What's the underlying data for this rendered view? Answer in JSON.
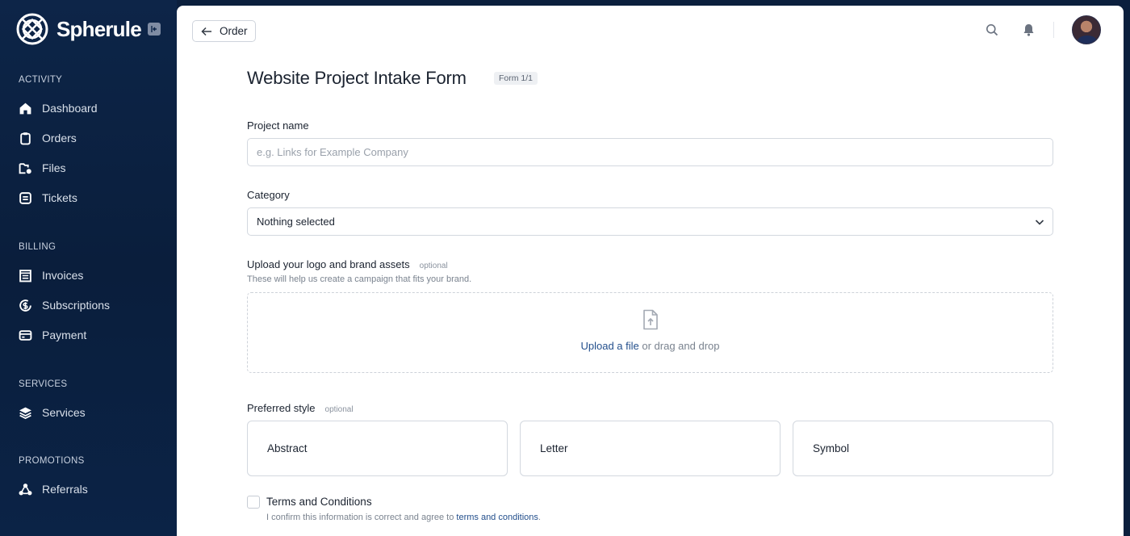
{
  "brand": {
    "name": "Spherule"
  },
  "sidebar": {
    "sections": [
      {
        "label": "ACTIVITY",
        "items": [
          {
            "label": "Dashboard",
            "icon": "home-icon"
          },
          {
            "label": "Orders",
            "icon": "clipboard-icon"
          },
          {
            "label": "Files",
            "icon": "folder-icon"
          },
          {
            "label": "Tickets",
            "icon": "ticket-icon"
          }
        ]
      },
      {
        "label": "BILLING",
        "items": [
          {
            "label": "Invoices",
            "icon": "receipt-icon"
          },
          {
            "label": "Subscriptions",
            "icon": "dollar-cycle-icon"
          },
          {
            "label": "Payment",
            "icon": "credit-card-icon"
          }
        ]
      },
      {
        "label": "SERVICES",
        "items": [
          {
            "label": "Services",
            "icon": "stack-icon"
          }
        ]
      },
      {
        "label": "PROMOTIONS",
        "items": [
          {
            "label": "Referrals",
            "icon": "share-nodes-icon"
          }
        ]
      }
    ]
  },
  "header": {
    "back_label": "Order"
  },
  "form": {
    "title": "Website Project Intake Form",
    "badge": "Form 1/1",
    "project_name": {
      "label": "Project name",
      "placeholder": "e.g. Links for Example Company",
      "value": ""
    },
    "category": {
      "label": "Category",
      "value": "Nothing selected"
    },
    "upload": {
      "label": "Upload your logo and brand assets",
      "optional": "optional",
      "hint": "These will help us create a campaign that fits your brand.",
      "link_text": "Upload a file",
      "rest_text": " or drag and drop"
    },
    "style": {
      "label": "Preferred style",
      "optional": "optional",
      "options": [
        "Abstract",
        "Letter",
        "Symbol"
      ]
    },
    "terms": {
      "label": "Terms and Conditions",
      "sub_text": "I confirm this information is correct and agree to ",
      "link_text": "terms and conditions",
      "sub_end": ".",
      "checked": false
    }
  },
  "colors": {
    "sidebar_bg": "#0b1f3d",
    "link": "#234f8c",
    "text": "#1b2330"
  }
}
